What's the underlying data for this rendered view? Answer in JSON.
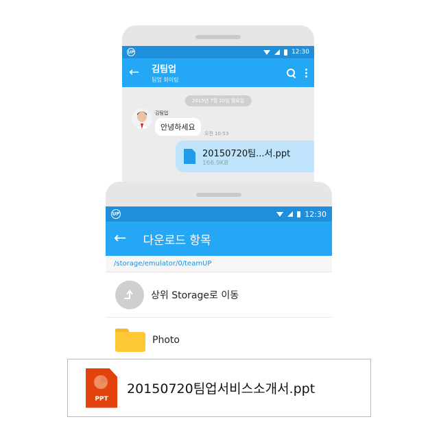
{
  "chat": {
    "status_time": "12:30",
    "status_logo": "UP",
    "title": "김팀업",
    "subtitle": "팀업 회이팅",
    "date_divider": "2015년 7월 20일 월요일",
    "sender_name": "김팀업",
    "message": "안녕하세요",
    "message_time": "오전 10:53",
    "file_name": "20150720팀...서.ppt",
    "file_size": "166.9KB",
    "icons": [
      "back-arrow-icon",
      "search-icon",
      "more-vert-icon",
      "document-icon"
    ]
  },
  "browser": {
    "status_time": "12:30",
    "status_logo": "UP",
    "title": "다운로드 항목",
    "path": "/storage/emulator/0/teamUP",
    "up_label": "상위 Storage로 이동",
    "folder_label": "Photo",
    "icons": [
      "back-arrow-icon",
      "folder-up-icon",
      "folder-icon"
    ]
  },
  "highlight": {
    "file_name": "20150720팀업서비스소개서.ppt",
    "badge": "PPT",
    "icon": "ppt-file-icon"
  },
  "colors": {
    "statusbar": "#1f8fdc",
    "appbar": "#24a8f5",
    "bubble_out": "#bfe3fa",
    "ppt": "#e2420c",
    "folder": "#ffc935"
  }
}
